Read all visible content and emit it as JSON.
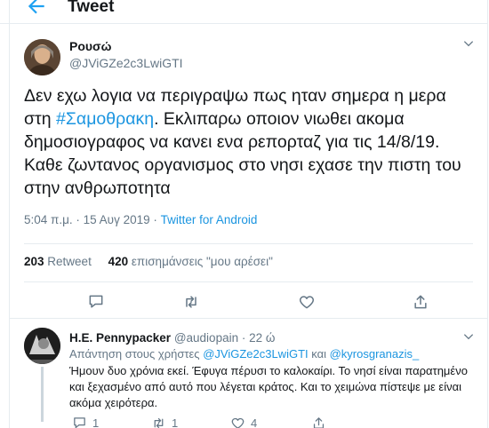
{
  "header": {
    "title": "Tweet"
  },
  "tweet": {
    "author_name": "Ρουσώ",
    "author_handle": "@JViGZe2c3LwiGTI",
    "text_before": "Δεν εχω λογια να περιγραψω πως ηταν σημερα η μερα στη ",
    "hashtag": "#Σαμοθρακη",
    "text_after": ". Εκλιπαρω οποιον νιωθει ακομα δημοσιογραφος να κανει ενα ρεπορταζ για τις 14/8/19. Καθε ζωντανος οργανισμος στο νησι εχασε την πιστη του στην ανθρωποτητα",
    "time": "5:04 π.μ.",
    "separator": "·",
    "date": "15 Αυγ 2019",
    "source": "Twitter for Android",
    "retweets_count": "203",
    "retweets_label": "Retweet",
    "likes_count": "420",
    "likes_label": "επισημάνσεις \"μου αρέσει\""
  },
  "reply": {
    "author_name": "H.E. Pennypacker",
    "author_handle": "@audiopain",
    "time": "22 ώ",
    "replying_prefix": "Απάντηση στους χρήστες ",
    "mention_1": "@JViGZe2c3LwiGTI",
    "conjunction": " και ",
    "mention_2": "@kyrosgranazis_",
    "text": "Ήμουν δυο χρόνια εκεί. Έφυγα πέρυσι το καλοκαίρι. Το νησί είναι παρατημένο και ξεχασμένο από αυτό που λέγεται κράτος. Και το χειμώνα πίστεψε με είναι ακόμα χειρότερα.",
    "reply_count": "1",
    "retweet_count": "1",
    "like_count": "4"
  },
  "icons": {
    "back": "arrow-left-icon",
    "caret": "chevron-down-icon",
    "reply": "comment-icon",
    "retweet": "retweet-icon",
    "like": "heart-icon",
    "share": "share-icon"
  },
  "colors": {
    "accent": "#1da1f2",
    "link": "#1b95e0",
    "muted": "#657786",
    "border": "#e6ecf0"
  }
}
